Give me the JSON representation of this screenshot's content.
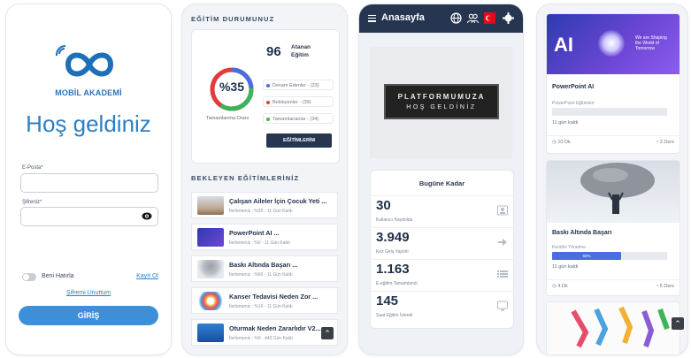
{
  "login": {
    "brand": "MOBİL AKADEMİ",
    "welcome": "Hoş geldiniz",
    "email_label": "E-Posta*",
    "password_label": "Şifreniz*",
    "remember_label": "Beni Hatırla",
    "register_link": "Kayıt Ol",
    "forgot_link": "Şifremi Unuttum",
    "login_button": "GİRİŞ"
  },
  "status": {
    "section_title": "EĞİTİM DURUMUNUZ",
    "completion_percent": "%35",
    "completion_fraction": 0.35,
    "completion_label": "Tamamlanma Oranı",
    "assigned_count": "96",
    "assigned_label": "Atanan Eğitim",
    "legend": [
      {
        "label": "Devam Edenler - (23)",
        "color": "#4a6de0"
      },
      {
        "label": "Bekleyenler - (39)",
        "color": "#e23b3b"
      },
      {
        "label": "Tamamlananlar - (34)",
        "color": "#3cb45a"
      }
    ],
    "button": "EĞİTİMLERİM"
  },
  "pending": {
    "section_title": "BEKLEYEN EĞİTİMLERİNİZ",
    "items": [
      {
        "title": "Çalışan Aileler İçin Çocuk Yeti ...",
        "sub": "İlerlemeniz : %35 - 11 Gün Kaldı"
      },
      {
        "title": "PowerPoint AI ...",
        "sub": "İlerlemeniz : %0 - 11 Gün Kaldı"
      },
      {
        "title": "Baskı Altında Başarı ...",
        "sub": "İlerlemeniz : %60 - 11 Gün Kaldı"
      },
      {
        "title": "Kanser Tedavisi Neden Zor ...",
        "sub": "İlerlemeniz : %16 - 11 Gün Kaldı"
      },
      {
        "title": "Oturmak Neden Zararlıdır V2...",
        "sub": "İlerlemeniz : %0 - 445 Gün Kaldı"
      }
    ]
  },
  "home": {
    "title": "Anasayfa",
    "banner_line1": "PLATFORMUMUZA",
    "banner_line2": "HOŞ GELDİNİZ",
    "stats_title": "Bugüne Kadar",
    "stats": [
      {
        "value": "30",
        "label": "Kullanıcı Kaydoldu",
        "icon": "user-card-icon"
      },
      {
        "value": "3.949",
        "label": "Kez Giriş Yapıldı",
        "icon": "login-arrow-icon"
      },
      {
        "value": "1.163",
        "label": "E-eğitim Tamamlandı",
        "icon": "list-icon"
      },
      {
        "value": "145",
        "label": "Saat Eğitim İzlendi",
        "icon": "monitor-icon"
      }
    ]
  },
  "courses": {
    "cards": [
      {
        "title": "PowerPoint AI",
        "category": "PowerPoint Eğitimleri",
        "progress": 0,
        "progress_text": "",
        "days": "11 gün kaldı",
        "duration": "10 Dk",
        "lessons": "3 Ders",
        "image_word": "AI",
        "image_side": "We are Shaping the World of Tomorrow"
      },
      {
        "title": "Baskı Altında Başarı",
        "category": "Kendini Yönetme",
        "progress": 0.6,
        "progress_text": "60%",
        "days": "11 gün kaldı",
        "duration": "4 Dk",
        "lessons": "5 Ders"
      }
    ]
  }
}
